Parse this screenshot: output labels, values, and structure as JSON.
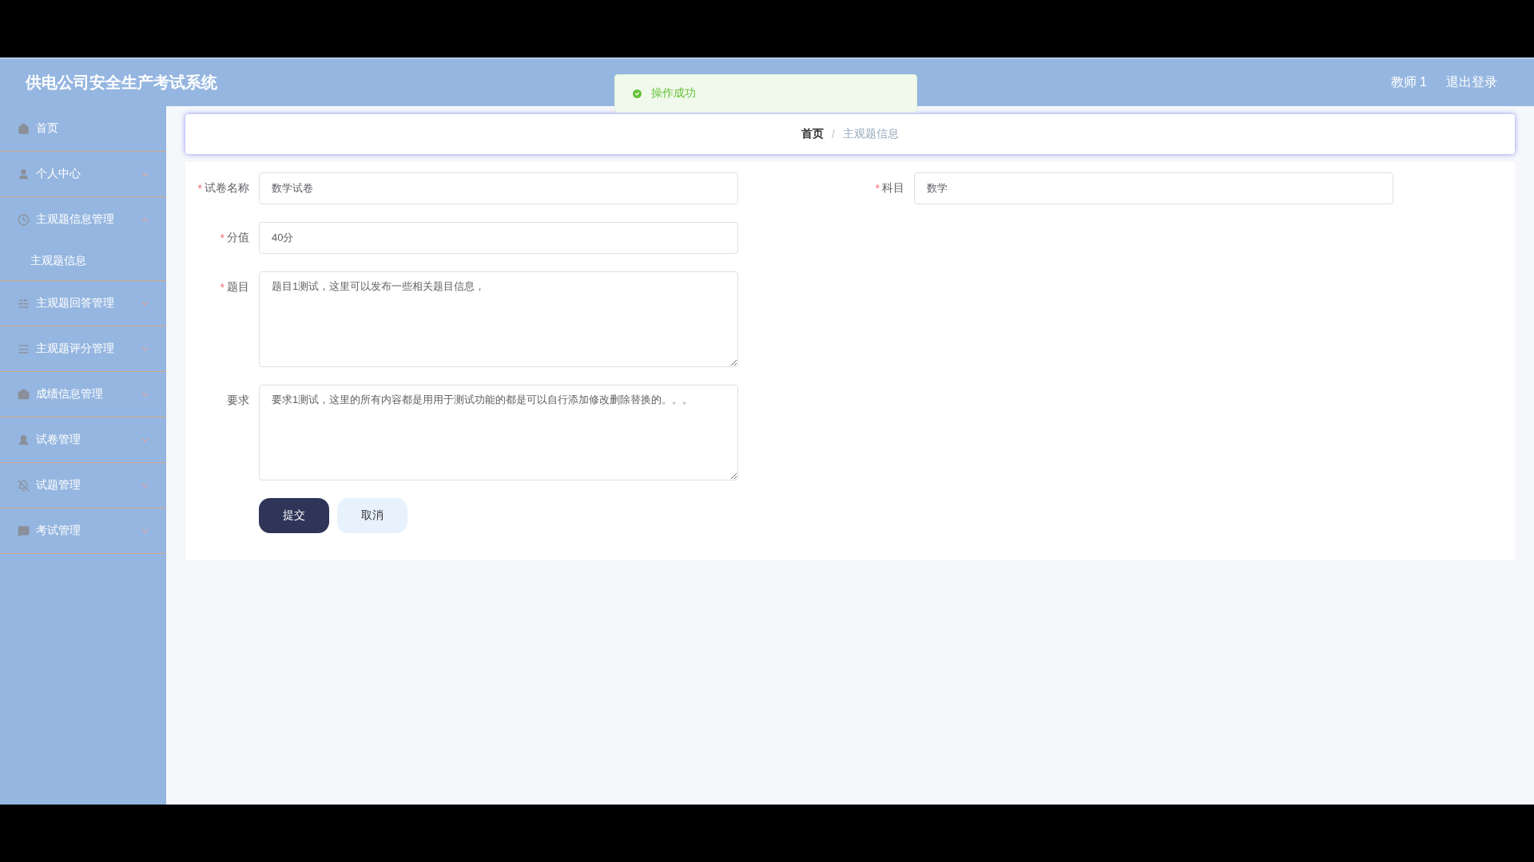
{
  "header": {
    "title": "供电公司安全生产考试系统",
    "user": "教师 1",
    "logout": "退出登录"
  },
  "toast": {
    "kind": "success",
    "message": "操作成功"
  },
  "sidebar": {
    "items": [
      {
        "kind": "link",
        "label": "首页"
      },
      {
        "kind": "menu",
        "label": "个人中心",
        "expanded": false
      },
      {
        "kind": "menu",
        "label": "主观题信息管理",
        "expanded": true,
        "children": [
          {
            "label": "主观题信息"
          }
        ]
      },
      {
        "kind": "menu",
        "label": "主观题回答管理",
        "expanded": false
      },
      {
        "kind": "menu",
        "label": "主观题评分管理",
        "expanded": false
      },
      {
        "kind": "menu",
        "label": "成绩信息管理",
        "expanded": false
      },
      {
        "kind": "menu",
        "label": "试卷管理",
        "expanded": false
      },
      {
        "kind": "menu",
        "label": "试题管理",
        "expanded": false
      },
      {
        "kind": "menu",
        "label": "考试管理",
        "expanded": false
      }
    ]
  },
  "breadcrumb": {
    "separator": "/",
    "items": [
      "首页",
      "主观题信息"
    ]
  },
  "form": {
    "rows": [
      [
        {
          "kind": "input",
          "label": "试卷名称",
          "required_mark": "*",
          "value": "数学试卷"
        },
        {
          "kind": "input",
          "label": "科目",
          "required_mark": "*",
          "value": "数学"
        }
      ],
      [
        {
          "kind": "input",
          "label": "分值",
          "required_mark": "*",
          "value": "40分"
        }
      ],
      [
        {
          "kind": "textarea",
          "label": "题目",
          "required_mark": "*",
          "value": "题目1测试，这里可以发布一些相关题目信息，"
        }
      ],
      [
        {
          "kind": "textarea",
          "label": "要求",
          "value": "要求1测试，这里的所有内容都是用用于测试功能的都是可以自行添加修改删除替换的。。。"
        }
      ]
    ],
    "buttons": [
      {
        "kind": "primary",
        "label": "提交"
      },
      {
        "kind": "secondary",
        "label": "取消"
      }
    ]
  }
}
